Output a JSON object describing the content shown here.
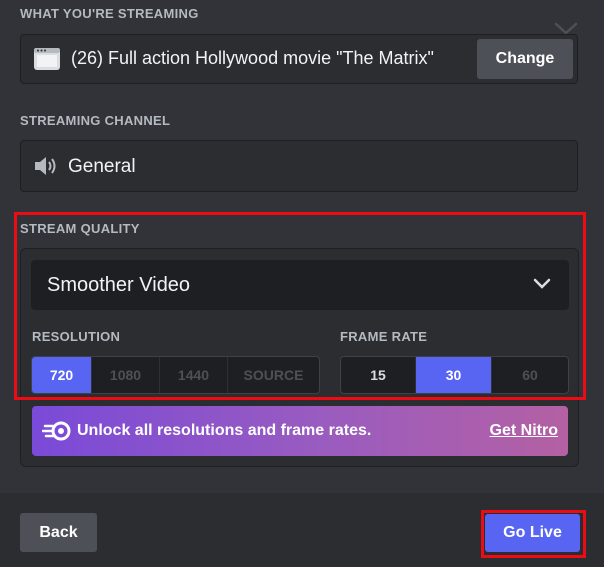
{
  "streaming_source": {
    "label": "WHAT YOU'RE STREAMING",
    "title": "(26) Full action Hollywood movie \"The Matrix\"",
    "change_label": "Change"
  },
  "streaming_channel": {
    "label": "STREAMING CHANNEL",
    "channel_name": "General"
  },
  "stream_quality": {
    "label": "STREAM QUALITY",
    "preset": "Smoother Video",
    "resolution_label": "RESOLUTION",
    "resolutions": [
      "720",
      "1080",
      "1440",
      "SOURCE"
    ],
    "selected_resolution": "720",
    "frame_rate_label": "FRAME RATE",
    "frame_rates": [
      "15",
      "30",
      "60"
    ],
    "selected_frame_rate": "30"
  },
  "nitro_banner": {
    "text": "Unlock all resolutions and frame rates.",
    "link": "Get Nitro"
  },
  "footer": {
    "back_label": "Back",
    "go_live_label": "Go Live"
  },
  "colors": {
    "accent": "#5865f2",
    "highlight": "#ed0c14",
    "background": "#313338"
  }
}
